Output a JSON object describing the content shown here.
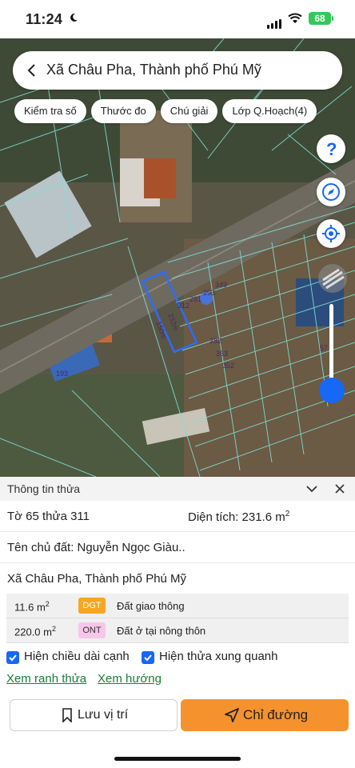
{
  "status_bar": {
    "time": "11:24",
    "battery": "68"
  },
  "search": {
    "title": "Xã Châu Pha, Thành phố Phú Mỹ"
  },
  "toolbar": {
    "chips": [
      "Kiểm tra số",
      "Thước đo",
      "Chú giải",
      "Lớp Q.Hoạch(4)"
    ]
  },
  "map": {
    "parcel_labels": [
      "349",
      "293",
      "291",
      "312",
      "282",
      "353",
      "352",
      "193",
      "57"
    ],
    "edge_labels": [
      "232m",
      "150m"
    ],
    "highlight_color": "#2b6cff"
  },
  "sheet": {
    "title": "Thông tin thửa",
    "sheet_info": "Tờ 65 thửa 311",
    "area_label": "Diện tích: 231.6 m",
    "area_sup": "2",
    "owner": "Tên chủ đất: Nguyễn Ngọc Giàu..",
    "address": "Xã Châu Pha, Thành phố Phú Mỹ",
    "land_use": [
      {
        "area": "11.6 m",
        "sup": "2",
        "code": "DGT",
        "name": "Đất giao thông",
        "code_bg": "#f5a623",
        "code_color": "#ffffff"
      },
      {
        "area": "220.0 m",
        "sup": "2",
        "code": "ONT",
        "name": "Đất ở tại nông thôn",
        "code_bg": "#f7c6ea",
        "code_color": "#333333"
      }
    ],
    "checkbox_edges": "Hiện chiều dài cạnh",
    "checkbox_neighbors": "Hiện thửa xung quanh",
    "link_boundary": "Xem ranh thửa",
    "link_direction": "Xem hướng",
    "save_label": "Lưu vị trí",
    "route_label": "Chỉ đường"
  }
}
